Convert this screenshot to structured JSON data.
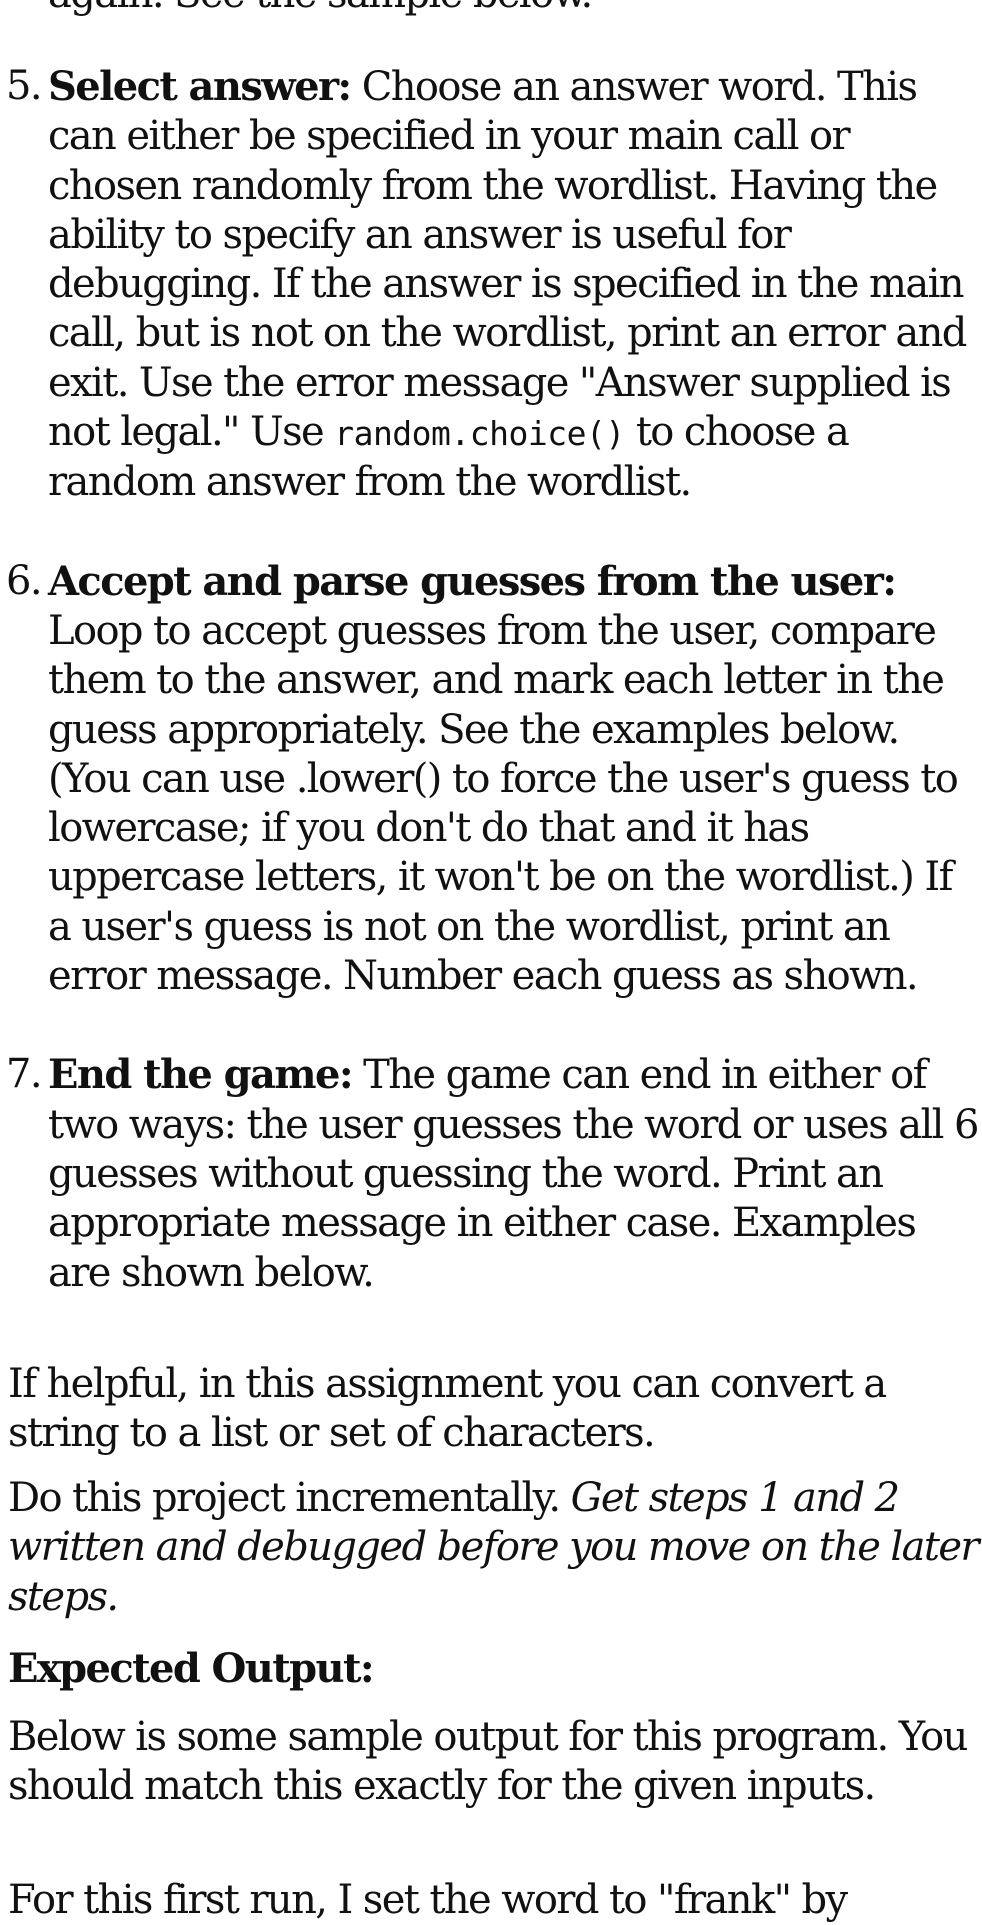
{
  "top_fragment": "again. See the sample below.",
  "steps": [
    {
      "number": "5.",
      "title": "Select answer:",
      "text_before_code": " Choose an answer word. This can either be specified in your main call or chosen randomly from the wordlist. Having the ability to specify an answer is useful for debugging. If the answer is specified in the main call, but is not on the wordlist, print an error and exit. Use the error message \"Answer supplied is not legal.\" Use ",
      "code": "random.choice()",
      "text_after_code": " to choose a random answer from the wordlist."
    },
    {
      "number": "6.",
      "title": "Accept and parse guesses from the user:",
      "text": " Loop to accept guesses from the user, compare them to the answer, and mark each letter in the guess appropriately. See the examples below. (You can use .lower() to force the user's guess to lowercase; if you don't do that and it has uppercase letters, it won't be on the wordlist.) If a user's guess is not on the wordlist, print an error message. Number each guess as shown."
    },
    {
      "number": "7.",
      "title": "End the game:",
      "text": " The game can end in either of two ways: the user guesses the word or uses all 6 guesses without guessing the word. Print an appropriate message in either case. Examples are shown below."
    }
  ],
  "para_helpful": "If helpful, in this assignment you can convert a string to a list or set of characters.",
  "para_incremental": {
    "normal": "Do this project incrementally. ",
    "italic": "Get steps 1 and 2 written and debugged before you move on the later steps."
  },
  "heading_expected": "Expected Output:",
  "para_below": "Below is some sample output for this program. You should match this exactly for the given inputs.",
  "para_first_run": "For this first run, I set the word to \"frank\" by"
}
